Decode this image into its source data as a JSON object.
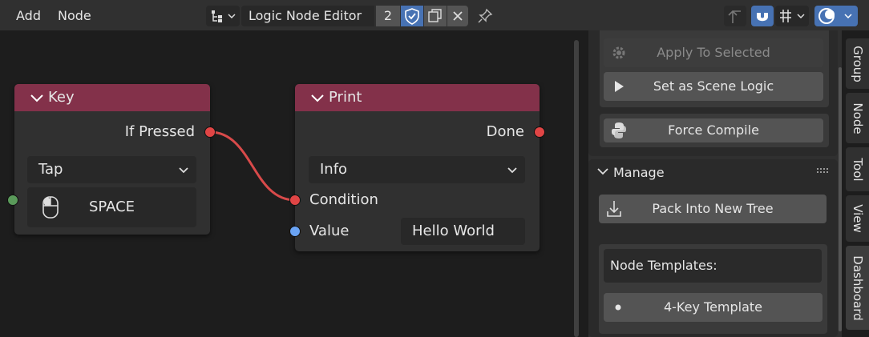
{
  "header": {
    "menu_add": "Add",
    "menu_node": "Node",
    "tree_name": "Logic Node Editor",
    "users_count": "2"
  },
  "nodes": {
    "key": {
      "title": "Key",
      "out_socket": "If Pressed",
      "mode_value": "Tap",
      "key_value": "SPACE"
    },
    "print": {
      "title": "Print",
      "out_socket": "Done",
      "type_value": "Info",
      "in_condition": "Condition",
      "in_value": "Value",
      "value_text": "Hello World"
    }
  },
  "sidebar": {
    "apply_selected": "Apply To Selected",
    "set_scene_logic": "Set as Scene Logic",
    "force_compile": "Force Compile",
    "manage_title": "Manage",
    "pack_tree": "Pack Into New Tree",
    "templates_label": "Node Templates:",
    "template_4key": "4-Key Template"
  },
  "tabs": [
    "Group",
    "Node",
    "Tool",
    "View",
    "Dashboard"
  ],
  "colors": {
    "node_header": "#83314a",
    "socket_red": "#e04545",
    "socket_blue": "#6aa4f5",
    "socket_green": "#5a9a5a",
    "accent_blue": "#4772b3"
  }
}
